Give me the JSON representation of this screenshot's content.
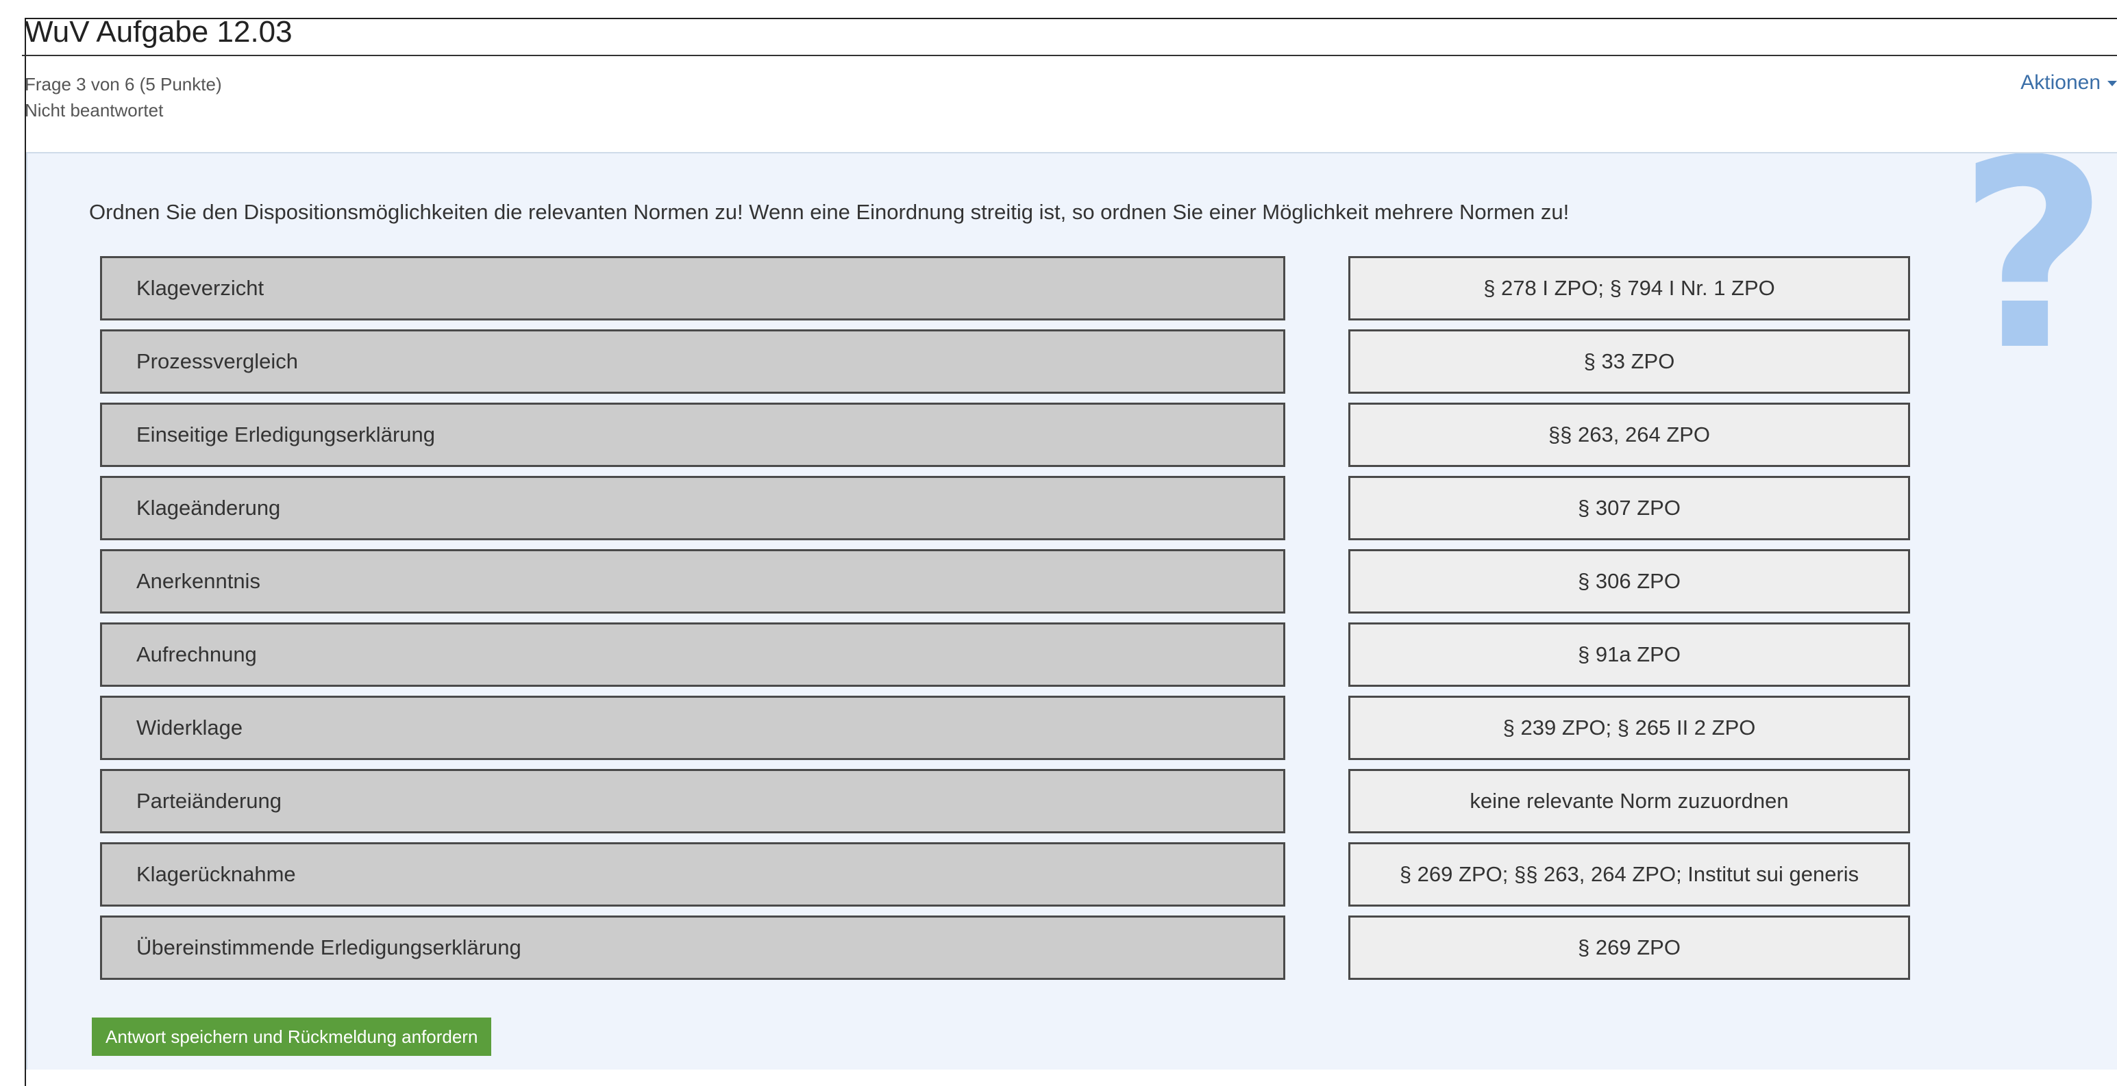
{
  "header": {
    "title": "WuV Aufgabe 12.03",
    "question_info": "Frage 3 von 6 (5 Punkte)",
    "status": "Nicht beantwortet",
    "actions_label": "Aktionen"
  },
  "question": {
    "icon": "question-mark-icon",
    "prompt": "Ordnen Sie den Dispositionsmöglichkeiten die relevanten Normen zu! Wenn eine Einordnung streitig ist, so ordnen Sie einer Möglichkeit mehrere Normen zu!",
    "pairs": [
      {
        "term": "Klageverzicht",
        "answer": "§ 278 I ZPO; § 794 I Nr. 1 ZPO"
      },
      {
        "term": "Prozessvergleich",
        "answer": "§ 33 ZPO"
      },
      {
        "term": "Einseitige Erledigungserklärung",
        "answer": "§§ 263, 264 ZPO"
      },
      {
        "term": "Klageänderung",
        "answer": "§ 307 ZPO"
      },
      {
        "term": "Anerkenntnis",
        "answer": "§ 306 ZPO"
      },
      {
        "term": "Aufrechnung",
        "answer": "§ 91a ZPO"
      },
      {
        "term": "Widerklage",
        "answer": "§ 239 ZPO; § 265 II 2 ZPO"
      },
      {
        "term": "Parteiänderung",
        "answer": "keine relevante Norm zuzuordnen"
      },
      {
        "term": "Klagerücknahme",
        "answer": "§ 269 ZPO; §§ 263, 264 ZPO; Institut sui generis"
      },
      {
        "term": "Übereinstimmende Erledigungserklärung",
        "answer": "§ 269 ZPO"
      }
    ],
    "submit_label": "Antwort speichern und Rückmeldung anfordern"
  },
  "colors": {
    "panel_bg": "#eff4fc",
    "accent_link": "#3b6fa8",
    "submit_bg": "#5b9e3c",
    "question_icon": "#a8c9f0"
  }
}
